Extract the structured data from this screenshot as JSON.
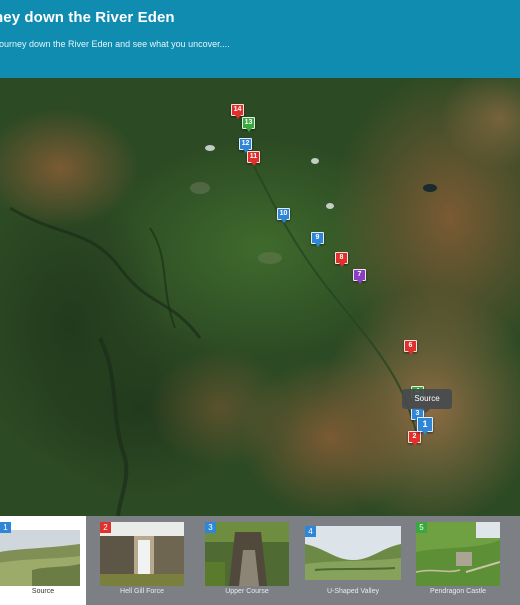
{
  "header": {
    "title": "ney down the River Eden",
    "subtitle": "journey down the River Eden and see what you uncover...."
  },
  "colors": {
    "header_bg": "#0f8cb0",
    "marker_red": "#e0302c",
    "marker_blue": "#2f86d6",
    "marker_green": "#3aa83f",
    "marker_purple": "#8a3fc0"
  },
  "map": {
    "markers": [
      {
        "label": "14",
        "color": "red"
      },
      {
        "label": "13",
        "color": "green"
      },
      {
        "label": "12",
        "color": "blue"
      },
      {
        "label": "11",
        "color": "red"
      },
      {
        "label": "10",
        "color": "blue"
      },
      {
        "label": "9",
        "color": "blue"
      },
      {
        "label": "8",
        "color": "red"
      },
      {
        "label": "7",
        "color": "purple"
      },
      {
        "label": "6",
        "color": "red"
      },
      {
        "label": "4",
        "color": "green"
      },
      {
        "label": "3",
        "color": "blue"
      },
      {
        "label": "2",
        "color": "red"
      },
      {
        "label": "1",
        "color": "blue"
      }
    ],
    "tooltip": "Source"
  },
  "carousel": {
    "items": [
      {
        "number": "1",
        "title": "Source",
        "color": "blue",
        "active": true
      },
      {
        "number": "2",
        "title": "Hell Gill Force",
        "color": "red",
        "active": false
      },
      {
        "number": "3",
        "title": "Upper Course",
        "color": "blue",
        "active": false
      },
      {
        "number": "4",
        "title": "U-Shaped Valley",
        "color": "blue",
        "active": false
      },
      {
        "number": "5",
        "title": "Pendragon Castle",
        "color": "green",
        "active": false
      }
    ]
  }
}
